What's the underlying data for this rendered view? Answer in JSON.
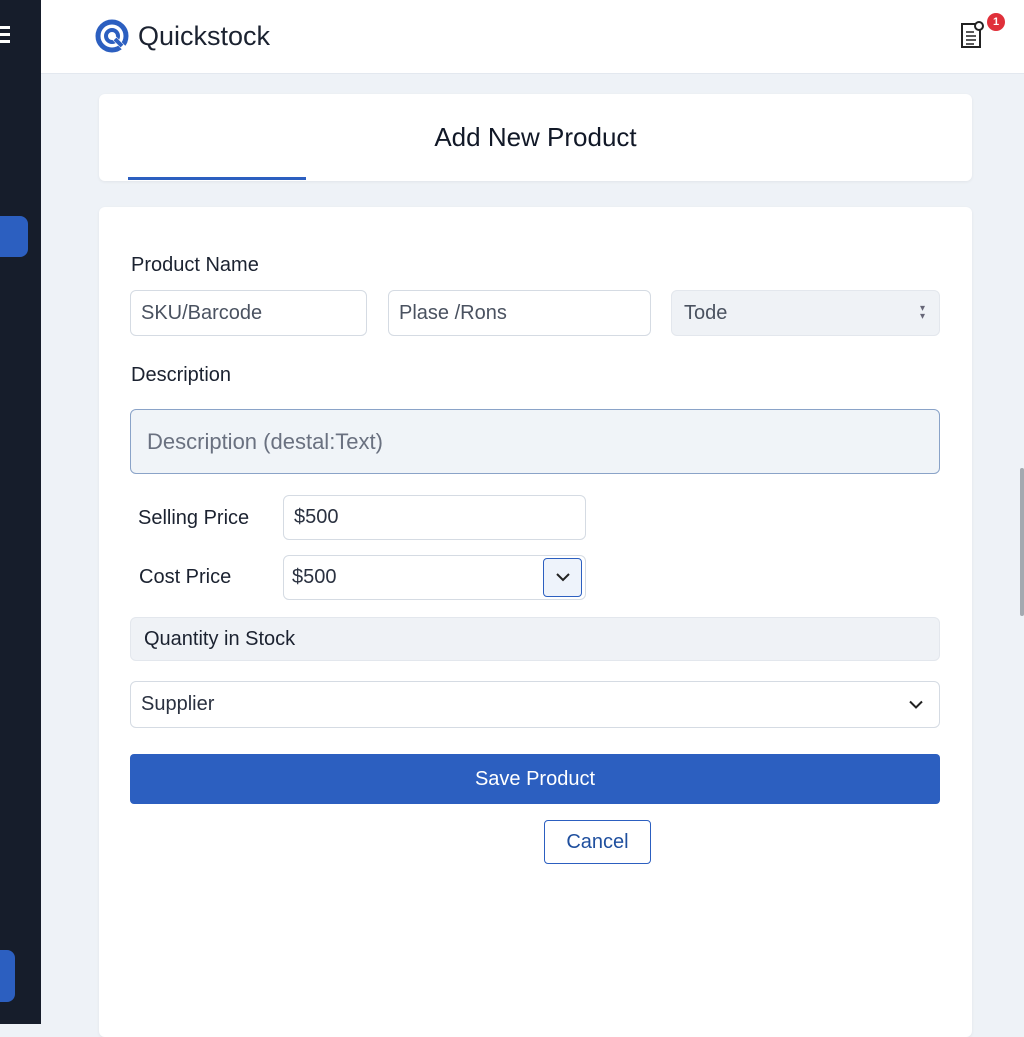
{
  "app": {
    "name": "Quickstock",
    "notification_count": "1",
    "accent": "#2c5fc0"
  },
  "page": {
    "title": "Add New Product"
  },
  "form": {
    "product_name_label": "Product Name",
    "sku_placeholder": "SKU/Barcode",
    "field2_placeholder": "Plase /Rons",
    "select3_value": "Tode",
    "description_label": "Description",
    "description_placeholder": "Description (destal:Text)",
    "selling_price_label": "Selling Price",
    "selling_price_value": "$500",
    "cost_price_label": "Cost Price",
    "cost_price_value": "$500",
    "quantity_label": "Quantity in Stock",
    "supplier_value": "Supplier",
    "save_label": "Save Product",
    "cancel_label": "Cancel"
  }
}
